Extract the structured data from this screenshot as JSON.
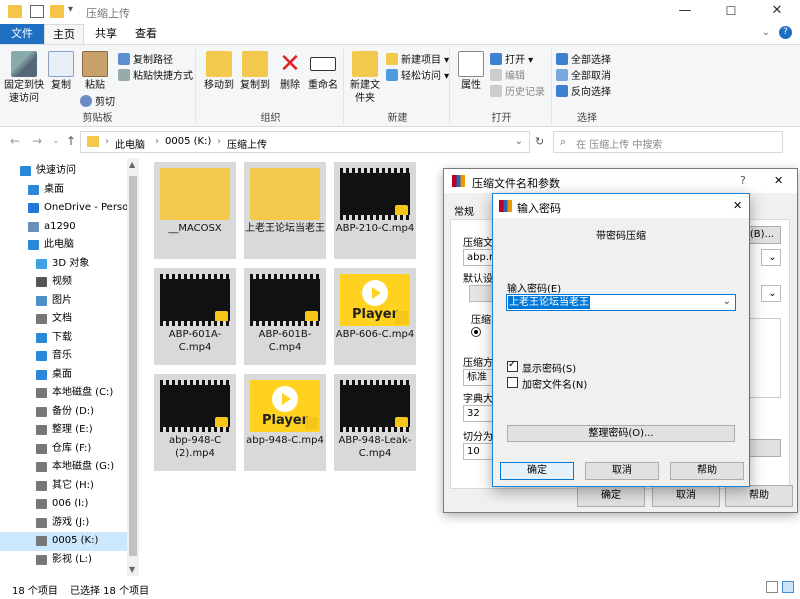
{
  "window": {
    "title": "压缩上传",
    "controls": {
      "minimize": "—",
      "maximize": "☐",
      "close": "✕"
    }
  },
  "ribbon_tabs": [
    "文件",
    "主页",
    "共享",
    "查看"
  ],
  "ribbon": {
    "clipboard": {
      "pin": "固定到快速访问",
      "copy": "复制",
      "paste": "粘贴",
      "copy_path": "复制路径",
      "paste_shortcut": "粘贴快捷方式",
      "cut": "剪切",
      "label": "剪贴板"
    },
    "organize": {
      "move_to": "移动到",
      "copy_to": "复制到",
      "delete": "删除",
      "rename": "重命名",
      "label": "组织"
    },
    "new": {
      "new_folder": "新建文件夹",
      "new_item": "新建项目",
      "easy_access": "轻松访问",
      "label": "新建"
    },
    "open": {
      "properties": "属性",
      "open": "打开",
      "edit": "编辑",
      "history": "历史记录",
      "label": "打开"
    },
    "select": {
      "select_all": "全部选择",
      "select_none": "全部取消",
      "invert": "反向选择",
      "label": "选择"
    }
  },
  "address": {
    "path": [
      "此电脑",
      "0005 (K:)",
      "压缩上传"
    ],
    "search_placeholder": "在 压缩上传 中搜索"
  },
  "sidebar": [
    {
      "label": "快速访问",
      "icon": "star-icon",
      "indent": 0,
      "color": "#2b88d8"
    },
    {
      "label": "桌面",
      "icon": "desktop-icon",
      "indent": 1,
      "color": "#2b88d8"
    },
    {
      "label": "OneDrive - Personal",
      "icon": "cloud-icon",
      "indent": 1,
      "color": "#1e78d4"
    },
    {
      "label": "a1290",
      "icon": "user-icon",
      "indent": 1,
      "color": "#6a8fb8"
    },
    {
      "label": "此电脑",
      "icon": "computer-icon",
      "indent": 1,
      "color": "#2b88d8"
    },
    {
      "label": "3D 对象",
      "icon": "cube-icon",
      "indent": 2,
      "color": "#3fa2e6"
    },
    {
      "label": "视频",
      "icon": "video-icon",
      "indent": 2,
      "color": "#555"
    },
    {
      "label": "图片",
      "icon": "picture-icon",
      "indent": 2,
      "color": "#4f8fc7"
    },
    {
      "label": "文档",
      "icon": "document-icon",
      "indent": 2,
      "color": "#777"
    },
    {
      "label": "下载",
      "icon": "download-icon",
      "indent": 2,
      "color": "#2b88d8"
    },
    {
      "label": "音乐",
      "icon": "music-icon",
      "indent": 2,
      "color": "#2b88d8"
    },
    {
      "label": "桌面",
      "icon": "desktop-icon",
      "indent": 2,
      "color": "#2b88d8"
    },
    {
      "label": "本地磁盘 (C:)",
      "icon": "drive-icon",
      "indent": 2,
      "color": "#777"
    },
    {
      "label": "备份 (D:)",
      "icon": "drive-icon",
      "indent": 2,
      "color": "#777"
    },
    {
      "label": "整理 (E:)",
      "icon": "drive-icon",
      "indent": 2,
      "color": "#777"
    },
    {
      "label": "仓库 (F:)",
      "icon": "drive-icon",
      "indent": 2,
      "color": "#777"
    },
    {
      "label": "本地磁盘 (G:)",
      "icon": "drive-icon",
      "indent": 2,
      "color": "#777"
    },
    {
      "label": "其它 (H:)",
      "icon": "drive-icon",
      "indent": 2,
      "color": "#777"
    },
    {
      "label": "006 (I:)",
      "icon": "drive-icon",
      "indent": 2,
      "color": "#777"
    },
    {
      "label": "游戏 (J:)",
      "icon": "drive-icon",
      "indent": 2,
      "color": "#777"
    },
    {
      "label": "0005 (K:)",
      "icon": "drive-icon",
      "indent": 2,
      "color": "#777",
      "selected": true
    },
    {
      "label": "影视 (L:)",
      "icon": "drive-icon",
      "indent": 2,
      "color": "#777"
    }
  ],
  "files": [
    {
      "name": "__MACOSX",
      "kind": "folder"
    },
    {
      "name": "上老王论坛当老王",
      "kind": "folder"
    },
    {
      "name": "ABP-210-C.mp4",
      "kind": "video"
    },
    {
      "name": "ABP-601A-C.mp4",
      "kind": "video"
    },
    {
      "name": "ABP-601B-C.mp4",
      "kind": "video"
    },
    {
      "name": "ABP-606-C.mp4",
      "kind": "player"
    },
    {
      "name": "abp-948-C (2).mp4",
      "kind": "video"
    },
    {
      "name": "abp-948-C.mp4",
      "kind": "player"
    },
    {
      "name": "ABP-948-Leak-C.mp4",
      "kind": "video"
    }
  ],
  "player_word": "Player",
  "status": {
    "count": "18 个项目",
    "selected": "已选择 18 个项目"
  },
  "compress_dialog": {
    "title": "压缩文件名和参数",
    "help": "?",
    "close": "✕",
    "tab": "常规",
    "archive_label": "压缩文",
    "archive_value": "abp.ra",
    "browse": "(B)...",
    "default_label": "默认设",
    "method_label": "压缩方",
    "method_value": "标准",
    "dict_label": "字典大",
    "dict_value": "32",
    "split_label": "切分为",
    "split_value": "10",
    "format_label": "压缩",
    "ok": "确定",
    "cancel": "取消",
    "help_btn": "帮助"
  },
  "password_dialog": {
    "title": "输入密码",
    "close": "✕",
    "heading": "带密码压缩",
    "input_label": "输入密码(E)",
    "password_value": "上老王论坛当老王",
    "show_password": "显示密码(S)",
    "encrypt_names": "加密文件名(N)",
    "organize": "整理密码(O)...",
    "ok": "确定",
    "cancel": "取消",
    "help": "帮助"
  }
}
